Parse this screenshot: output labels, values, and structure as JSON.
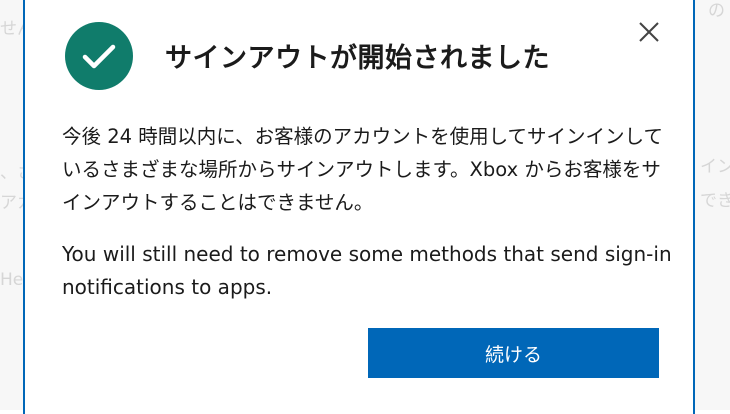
{
  "background": {
    "fragments_left": [
      "せん",
      "、さ",
      "アカ",
      "He"
    ],
    "fragments_right": [
      "の",
      "イン",
      "でき"
    ]
  },
  "dialog": {
    "title": "サインアウトが開始されました",
    "body_jp": "今後 24 時間以内に、お客様のアカウントを使用してサインインしているさまざまな場所からサインアウトします。Xbox からお客様をサインアウトすることはできません。",
    "body_en": "You will still need to remove some methods that send sign-in notifications to apps.",
    "continue_label": "続ける",
    "close_icon": "close-icon",
    "status_icon": "checkmark-icon"
  },
  "colors": {
    "accent": "#0067b8",
    "success": "#107c6b"
  }
}
